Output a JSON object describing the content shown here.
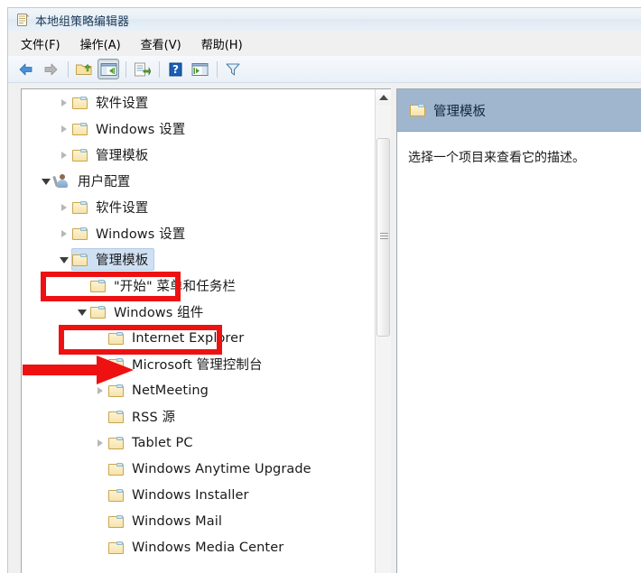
{
  "window": {
    "title": "本地组策略编辑器",
    "title_icon": "policy-document-icon"
  },
  "menubar": {
    "items": [
      {
        "label": "文件(F)",
        "name": "menu-file"
      },
      {
        "label": "操作(A)",
        "name": "menu-action"
      },
      {
        "label": "查看(V)",
        "name": "menu-view"
      },
      {
        "label": "帮助(H)",
        "name": "menu-help"
      }
    ]
  },
  "toolbar": {
    "buttons": [
      {
        "name": "back-icon",
        "tip": "后退"
      },
      {
        "name": "forward-icon",
        "tip": "前进"
      },
      {
        "name": "up-one-level-icon",
        "tip": "向上一级"
      },
      {
        "name": "show-hide-console-tree-icon",
        "tip": "显示/隐藏控制台树",
        "pressed": true
      },
      {
        "name": "export-list-icon",
        "tip": "导出列表"
      },
      {
        "name": "help-icon",
        "tip": "帮助"
      },
      {
        "name": "show-action-pane-icon",
        "tip": "显示操作窗格"
      },
      {
        "name": "filter-icon",
        "tip": "筛选器"
      }
    ]
  },
  "tree": {
    "items": [
      {
        "label": "软件设置",
        "indent": 1,
        "twisty": "collapsed",
        "icon": "folder-icon"
      },
      {
        "label": "Windows 设置",
        "indent": 1,
        "twisty": "collapsed",
        "icon": "folder-icon"
      },
      {
        "label": "管理模板",
        "indent": 1,
        "twisty": "collapsed",
        "icon": "folder-icon"
      },
      {
        "label": "用户配置",
        "indent": 0,
        "twisty": "expanded",
        "icon": "user-configuration-icon"
      },
      {
        "label": "软件设置",
        "indent": 1,
        "twisty": "collapsed",
        "icon": "folder-icon"
      },
      {
        "label": "Windows 设置",
        "indent": 1,
        "twisty": "collapsed",
        "icon": "folder-icon"
      },
      {
        "label": "管理模板",
        "indent": 1,
        "twisty": "expanded",
        "icon": "folder-icon",
        "selected": true
      },
      {
        "label": "\"开始\" 菜单和任务栏",
        "indent": 2,
        "twisty": "none",
        "icon": "folder-icon"
      },
      {
        "label": "Windows 组件",
        "indent": 2,
        "twisty": "expanded",
        "icon": "folder-icon"
      },
      {
        "label": "Internet Explorer",
        "indent": 3,
        "twisty": "none",
        "icon": "folder-icon"
      },
      {
        "label": "Microsoft 管理控制台",
        "indent": 3,
        "twisty": "collapsed",
        "icon": "folder-icon"
      },
      {
        "label": "NetMeeting",
        "indent": 3,
        "twisty": "collapsed",
        "icon": "folder-icon"
      },
      {
        "label": "RSS 源",
        "indent": 3,
        "twisty": "none",
        "icon": "folder-icon"
      },
      {
        "label": "Tablet PC",
        "indent": 3,
        "twisty": "collapsed",
        "icon": "folder-icon"
      },
      {
        "label": "Windows Anytime Upgrade",
        "indent": 3,
        "twisty": "none",
        "icon": "folder-icon"
      },
      {
        "label": "Windows Installer",
        "indent": 3,
        "twisty": "none",
        "icon": "folder-icon"
      },
      {
        "label": "Windows Mail",
        "indent": 3,
        "twisty": "none",
        "icon": "folder-icon"
      },
      {
        "label": "Windows Media Center",
        "indent": 3,
        "twisty": "none",
        "icon": "folder-icon"
      }
    ]
  },
  "scrollbar": {
    "up_arrow": "scroll-up-icon"
  },
  "right_pane": {
    "header_icon": "folder-icon",
    "header_title": "管理模板",
    "description": "选择一个项目来查看它的描述。"
  },
  "annotations": {
    "color": "#ee1111",
    "boxes": [
      {
        "name": "highlight-box-admin-templates",
        "target": "管理模板"
      },
      {
        "name": "highlight-box-windows-components",
        "target": "Windows 组件"
      }
    ],
    "arrow": {
      "name": "pointer-arrow-internet-explorer",
      "target": "Internet Explorer"
    }
  }
}
